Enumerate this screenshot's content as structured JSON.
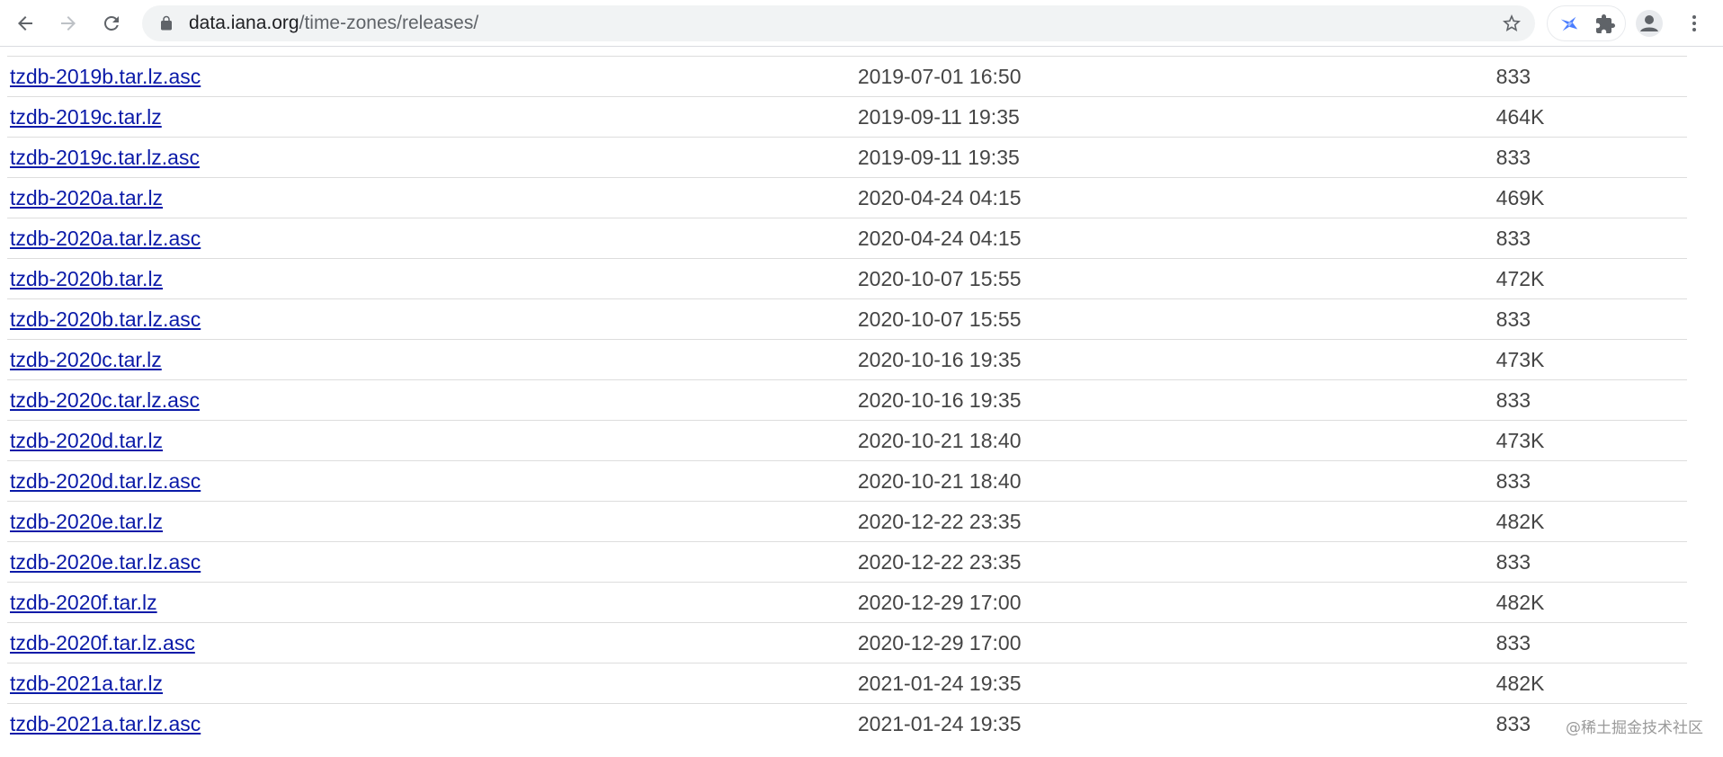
{
  "browser": {
    "url_host": "data.iana.org",
    "url_path": "/time-zones/releases/",
    "icons": {
      "back": "arrow-left-icon",
      "forward": "arrow-right-icon",
      "reload": "reload-icon",
      "lock": "lock-icon",
      "bookmark": "star-icon",
      "extension_1": "bird-extension-icon",
      "extensions": "puzzle-icon",
      "profile": "avatar-icon",
      "menu": "kebab-menu-icon"
    }
  },
  "files": [
    {
      "name": "tzdb-2019b.tar.lz.asc",
      "date": "2019-07-01 16:50",
      "size": "833"
    },
    {
      "name": "tzdb-2019c.tar.lz",
      "date": "2019-09-11 19:35",
      "size": "464K"
    },
    {
      "name": "tzdb-2019c.tar.lz.asc",
      "date": "2019-09-11 19:35",
      "size": "833"
    },
    {
      "name": "tzdb-2020a.tar.lz",
      "date": "2020-04-24 04:15",
      "size": "469K"
    },
    {
      "name": "tzdb-2020a.tar.lz.asc",
      "date": "2020-04-24 04:15",
      "size": "833"
    },
    {
      "name": "tzdb-2020b.tar.lz",
      "date": "2020-10-07 15:55",
      "size": "472K"
    },
    {
      "name": "tzdb-2020b.tar.lz.asc",
      "date": "2020-10-07 15:55",
      "size": "833"
    },
    {
      "name": "tzdb-2020c.tar.lz",
      "date": "2020-10-16 19:35",
      "size": "473K"
    },
    {
      "name": "tzdb-2020c.tar.lz.asc",
      "date": "2020-10-16 19:35",
      "size": "833"
    },
    {
      "name": "tzdb-2020d.tar.lz",
      "date": "2020-10-21 18:40",
      "size": "473K"
    },
    {
      "name": "tzdb-2020d.tar.lz.asc",
      "date": "2020-10-21 18:40",
      "size": "833"
    },
    {
      "name": "tzdb-2020e.tar.lz",
      "date": "2020-12-22 23:35",
      "size": "482K"
    },
    {
      "name": "tzdb-2020e.tar.lz.asc",
      "date": "2020-12-22 23:35",
      "size": "833"
    },
    {
      "name": "tzdb-2020f.tar.lz",
      "date": "2020-12-29 17:00",
      "size": "482K"
    },
    {
      "name": "tzdb-2020f.tar.lz.asc",
      "date": "2020-12-29 17:00",
      "size": "833"
    },
    {
      "name": "tzdb-2021a.tar.lz",
      "date": "2021-01-24 19:35",
      "size": "482K"
    },
    {
      "name": "tzdb-2021a.tar.lz.asc",
      "date": "2021-01-24 19:35",
      "size": "833"
    }
  ],
  "watermark": "@稀土掘金技术社区",
  "colors": {
    "link": "#0a1aa8",
    "text": "#444444",
    "row_border": "#dddddd",
    "omnibox_bg": "#f1f3f4"
  }
}
